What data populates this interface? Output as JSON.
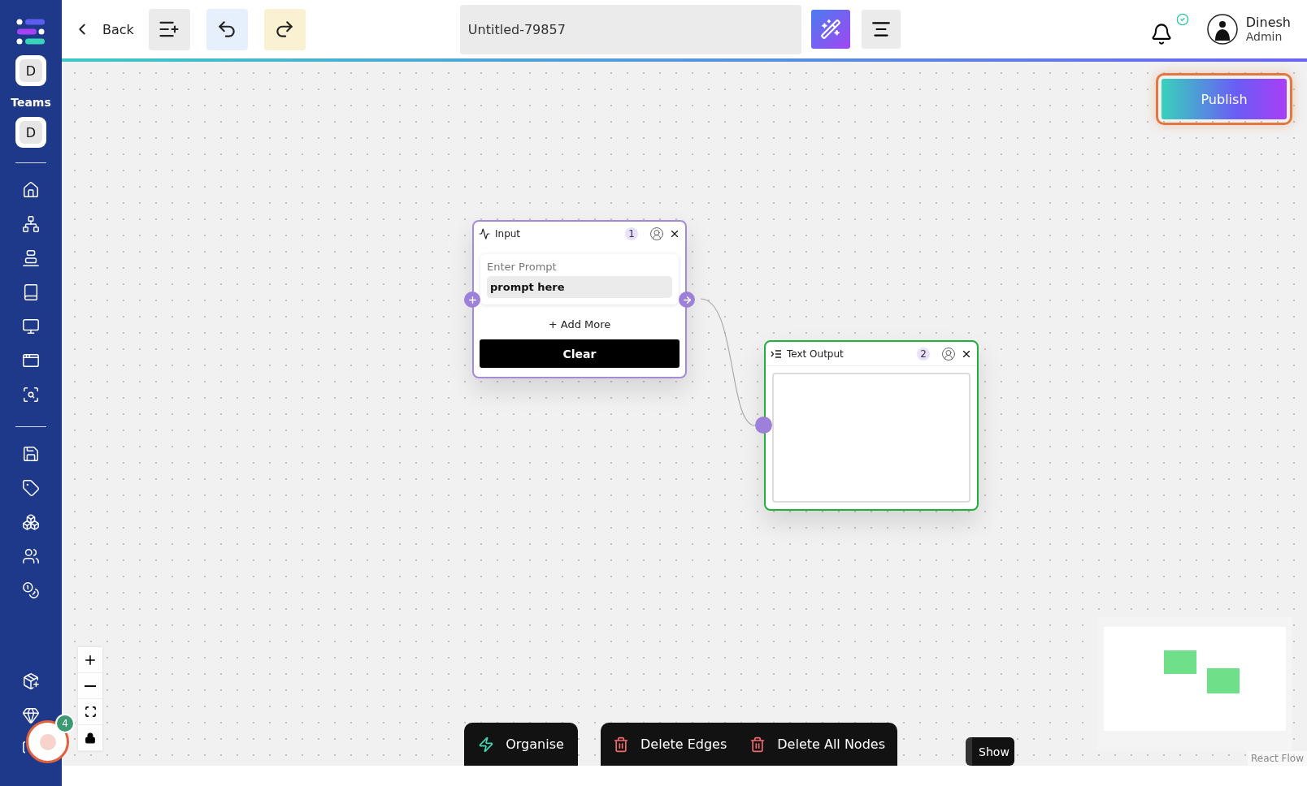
{
  "sidebar": {
    "team_avatars": [
      "D",
      "D"
    ],
    "teams_label": "Teams",
    "chat_badge": "4"
  },
  "toolbar": {
    "back_label": "Back",
    "title": "Untitled-79857"
  },
  "user": {
    "name": "Dinesh",
    "role": "Admin"
  },
  "publish_label": "Publish",
  "nodes": [
    {
      "kind": "input",
      "title": "Input",
      "number": "1",
      "field_label": "Enter Prompt",
      "value": "prompt here",
      "add_more": "+ Add More",
      "action": "Clear"
    },
    {
      "kind": "text_output",
      "title": "Text Output",
      "number": "2"
    }
  ],
  "action_groups": [
    {
      "actions": [
        {
          "kind": "organise",
          "label": "Organise"
        }
      ]
    },
    {
      "actions": [
        {
          "kind": "delete",
          "label": "Delete Edges"
        },
        {
          "kind": "delete",
          "label": "Delete All Nodes"
        }
      ]
    }
  ],
  "show_label": "Show",
  "attribution": "React Flow"
}
